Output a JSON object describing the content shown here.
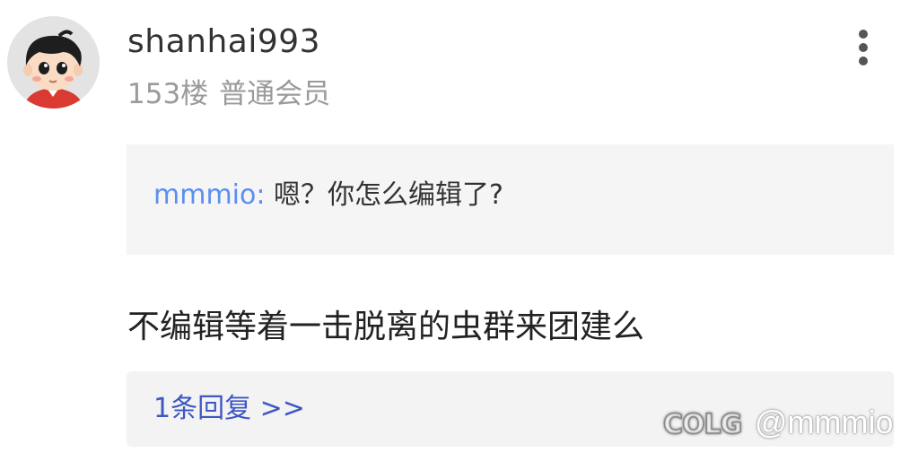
{
  "post": {
    "username": "shanhai993",
    "floor": "153楼",
    "member_level": "普通会员",
    "quote": {
      "author": "mmmio:",
      "text": " 嗯？你怎么编辑了?"
    },
    "body": "不编辑等着一击脱离的虫群来团建么",
    "reply_link": "1条回复 >>"
  },
  "icons": {
    "more": "more-vertical-icon",
    "avatar": "cartoon-boy-avatar"
  },
  "watermark": {
    "logo": "COLG",
    "handle": "@mmmio"
  },
  "colors": {
    "quote_author": "#5b8ff0",
    "reply_link": "#3e57c4",
    "meta": "#9a9a9a",
    "quote_background": "#f5f5f5"
  }
}
